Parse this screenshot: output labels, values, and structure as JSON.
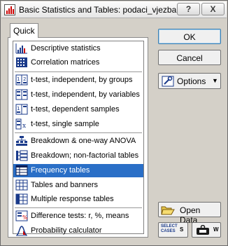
{
  "window": {
    "title": "Basic Statistics and Tables: podaci_vjezba",
    "help_label": "?",
    "close_label": "X"
  },
  "tabs": [
    {
      "label": "Quick"
    }
  ],
  "analyses": [
    {
      "label": "Descriptive statistics",
      "icon": "descriptive-stats-icon"
    },
    {
      "label": "Correlation matrices",
      "icon": "correlation-matrix-icon"
    },
    {
      "label": "t-test, independent, by groups",
      "icon": "ttest-groups-icon"
    },
    {
      "label": "t-test, independent, by variables",
      "icon": "ttest-variables-icon"
    },
    {
      "label": "t-test, dependent samples",
      "icon": "ttest-dependent-icon"
    },
    {
      "label": "t-test, single sample",
      "icon": "ttest-single-icon"
    },
    {
      "label": "Breakdown & one-way ANOVA",
      "icon": "breakdown-anova-icon"
    },
    {
      "label": "Breakdown; non-factorial tables",
      "icon": "breakdown-nonfactorial-icon"
    },
    {
      "label": "Frequency tables",
      "icon": "frequency-table-icon",
      "selected": true
    },
    {
      "label": "Tables and banners",
      "icon": "tables-banners-icon"
    },
    {
      "label": "Multiple response tables",
      "icon": "multiple-response-icon"
    },
    {
      "label": "Difference tests: r, %, means",
      "icon": "difference-tests-icon"
    },
    {
      "label": "Probability calculator",
      "icon": "probability-calculator-icon"
    }
  ],
  "buttons": {
    "ok": "OK",
    "cancel": "Cancel",
    "options": "Options",
    "open_data_prefix": "Open ",
    "open_data_underlined": "D",
    "open_data_suffix": "ata",
    "select_cases_line1": "SELECT",
    "select_cases_line2": "CASES",
    "select_cases_key": "S",
    "weight_key": "W"
  },
  "colors": {
    "selection": "#2a6fc7",
    "dialog_bg": "#d4d0c8",
    "icon_blue": "#1a3a8a"
  }
}
